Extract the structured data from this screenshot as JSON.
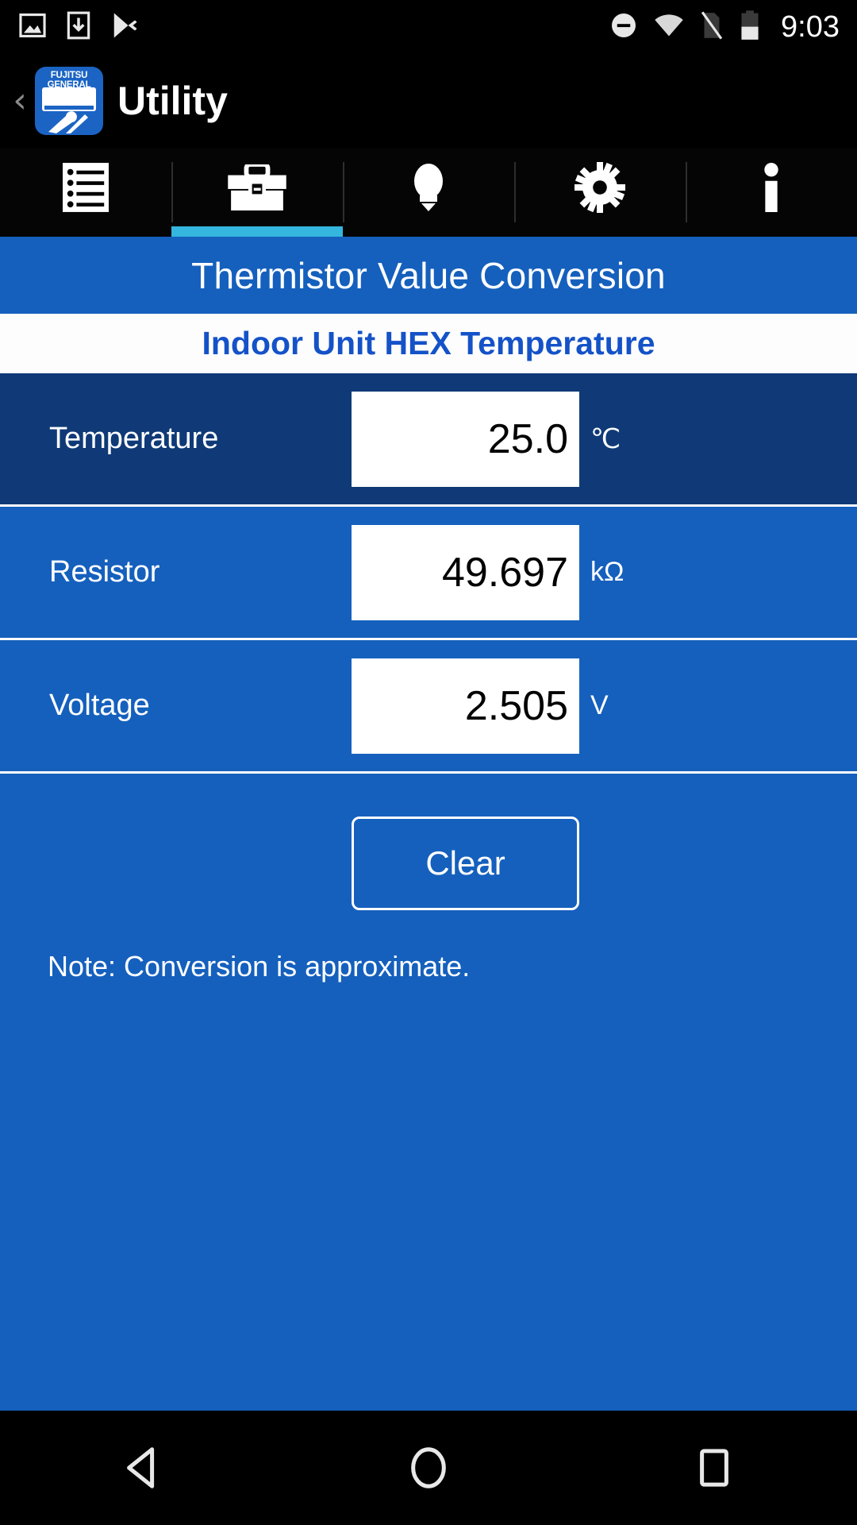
{
  "status_bar": {
    "icons": [
      "image-icon",
      "download-icon",
      "play-store-icon"
    ],
    "right_icons": [
      "do-not-disturb-icon",
      "wifi-icon",
      "no-sim-icon",
      "battery-icon"
    ],
    "time": "9:03"
  },
  "app_bar": {
    "back_label": "‹",
    "app_icon_brand": "FUJITSU GENERAL",
    "title": "Utility"
  },
  "tabs": [
    {
      "name": "list-tab",
      "icon": "list-icon",
      "active": false
    },
    {
      "name": "tools-tab",
      "icon": "toolbox-icon",
      "active": true
    },
    {
      "name": "tips-tab",
      "icon": "lightbulb-icon",
      "active": false
    },
    {
      "name": "settings-tab",
      "icon": "gear-icon",
      "active": false
    },
    {
      "name": "info-tab",
      "icon": "info-icon",
      "active": false
    }
  ],
  "content": {
    "section_title": "Thermistor Value Conversion",
    "subsection_title": "Indoor Unit HEX Temperature",
    "rows": [
      {
        "label": "Temperature",
        "value": "25.0",
        "unit": "℃",
        "style": "dark"
      },
      {
        "label": "Resistor",
        "value": "49.697",
        "unit": "kΩ",
        "style": "light"
      },
      {
        "label": "Voltage",
        "value": "2.505",
        "unit": "V",
        "style": "light"
      }
    ],
    "clear_label": "Clear",
    "note": "Note: Conversion is approximate."
  },
  "nav_bar": {
    "back": "back-icon",
    "home": "home-icon",
    "recents": "recents-icon"
  },
  "colors": {
    "accent_blue": "#1560bd",
    "dark_blue": "#0f3a77",
    "tab_indicator": "#35b6de",
    "title_blue": "#1452c8"
  }
}
